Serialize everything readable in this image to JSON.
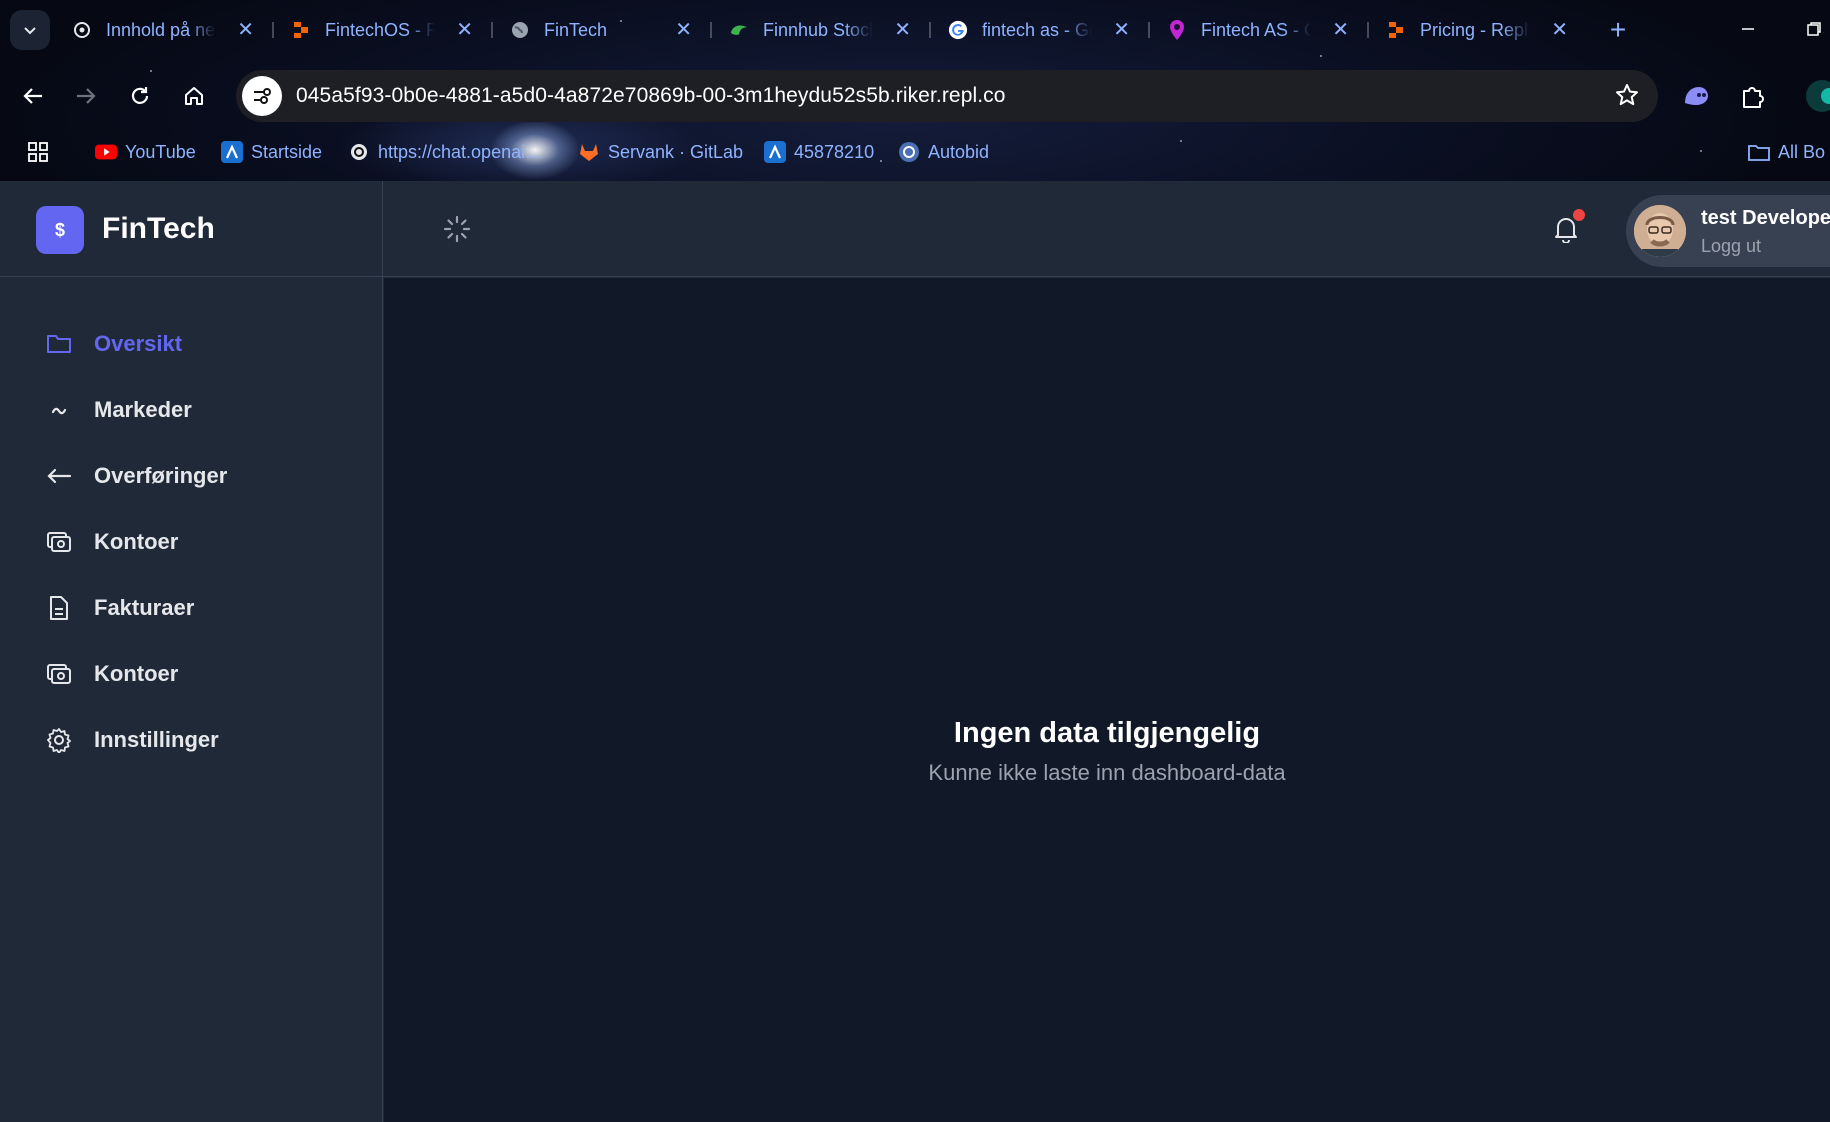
{
  "browser": {
    "tabs": [
      {
        "title": "Innhold på ne",
        "icon": "openai-icon"
      },
      {
        "title": "FintechOS - R",
        "icon": "replit-icon"
      },
      {
        "title": "FinTech",
        "icon": "globe-icon"
      },
      {
        "title": "Finnhub Stock",
        "icon": "finnhub-icon"
      },
      {
        "title": "fintech as - Go",
        "icon": "google-icon"
      },
      {
        "title": "Fintech AS - O",
        "icon": "location-pin-icon"
      },
      {
        "title": "Pricing - Repli",
        "icon": "replit-icon"
      }
    ],
    "url": "045a5f93-0b0e-4881-a5d0-4a872e70869b-00-3m1heydu52s5b.riker.repl.co",
    "bookmarks": [
      {
        "label": "YouTube"
      },
      {
        "label": "Startside"
      },
      {
        "label": "https://chat.openai..."
      },
      {
        "label": "Servank · GitLab"
      },
      {
        "label": "45878210"
      },
      {
        "label": "Autobid"
      },
      {
        "label": "All Bo"
      }
    ],
    "colors": {
      "tab_text": "#8fb3ff"
    }
  },
  "app": {
    "brand": {
      "logo_symbol": "$",
      "name": "FinTech"
    },
    "nav": [
      {
        "label": "Oversikt",
        "icon": "folder-icon",
        "active": true
      },
      {
        "label": "Markeder",
        "icon": "trend-icon",
        "active": false
      },
      {
        "label": "Overføringer",
        "icon": "arrow-left-icon",
        "active": false
      },
      {
        "label": "Kontoer",
        "icon": "wallet-icon",
        "active": false
      },
      {
        "label": "Fakturaer",
        "icon": "document-icon",
        "active": false
      },
      {
        "label": "Kontoer",
        "icon": "wallet-icon",
        "active": false
      },
      {
        "label": "Innstillinger",
        "icon": "gear-icon",
        "active": false
      }
    ],
    "user": {
      "name": "test Develope",
      "logout": "Logg ut"
    },
    "empty_state": {
      "title": "Ingen data tilgjengelig",
      "subtitle": "Kunne ikke laste inn dashboard-data"
    },
    "colors": {
      "accent": "#6366f1",
      "sidebar_bg": "#1f2937",
      "main_bg": "#111827",
      "notification_dot": "#ef4444"
    }
  }
}
